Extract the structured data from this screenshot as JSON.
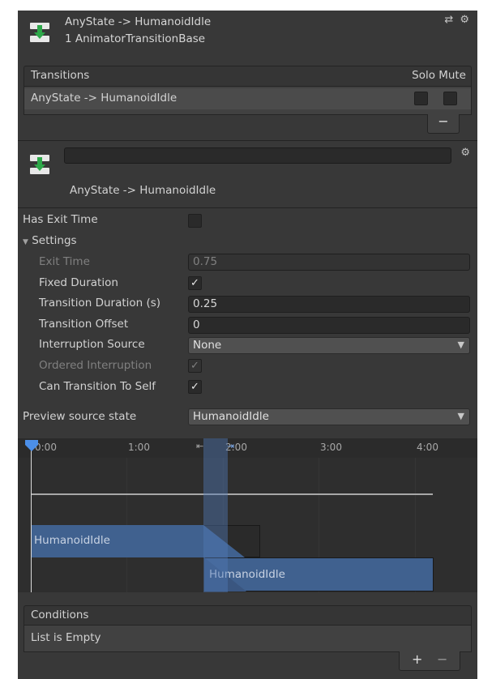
{
  "header": {
    "title": "AnyState -> HumanoidIdle",
    "subtitle": "1 AnimatorTransitionBase",
    "tools": "⇄ ⚙"
  },
  "transitions": {
    "header": "Transitions",
    "solo_label": "Solo",
    "mute_label": "Mute",
    "rows": [
      {
        "label": "AnyState -> HumanoidIdle",
        "solo": false,
        "mute": false
      }
    ],
    "remove_label": "−"
  },
  "transition": {
    "name_value": "",
    "title": "AnyState -> HumanoidIdle"
  },
  "properties": {
    "has_exit_time": {
      "label": "Has Exit Time",
      "checked": false
    },
    "settings_label": "Settings",
    "exit_time": {
      "label": "Exit Time",
      "value": "0.75"
    },
    "fixed_duration": {
      "label": "Fixed Duration",
      "checked": true
    },
    "transition_duration": {
      "label": "Transition Duration (s)",
      "value": "0.25"
    },
    "transition_offset": {
      "label": "Transition Offset",
      "value": "0"
    },
    "interruption_source": {
      "label": "Interruption Source",
      "value": "None"
    },
    "ordered_interruption": {
      "label": "Ordered Interruption",
      "checked": true
    },
    "can_transition_to_self": {
      "label": "Can Transition To Self",
      "checked": true
    },
    "preview_source_state": {
      "label": "Preview source state",
      "value": "HumanoidIdle"
    }
  },
  "timeline": {
    "ticks": [
      "0:00",
      "1:00",
      "2:00",
      "3:00",
      "4:00"
    ],
    "source_clip": "HumanoidIdle",
    "dest_clip": "HumanoidIdle"
  },
  "conditions": {
    "header": "Conditions",
    "empty_text": "List is Empty",
    "add_label": "+",
    "remove_label": "−"
  },
  "colors": {
    "panel": "#383838",
    "clip_blue": "#40618f",
    "field": "#2a2a2a"
  },
  "icons": {
    "transition": "transition-arrow-icon",
    "gear": "gear-icon",
    "preset": "preset-icon"
  }
}
